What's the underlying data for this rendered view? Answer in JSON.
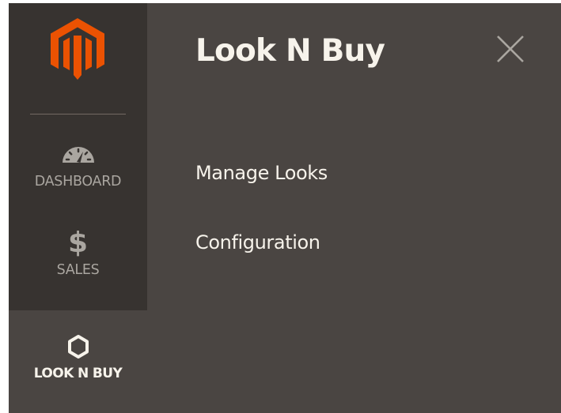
{
  "sidebar": {
    "logo": {
      "icon": "magento-logo-icon",
      "color": "#eb5202"
    },
    "items": [
      {
        "label": "DASHBOARD",
        "icon": "speedometer-icon"
      },
      {
        "label": "SALES",
        "icon": "dollar-sign-icon",
        "glyph": "$"
      },
      {
        "label": "LOOK N BUY",
        "icon": "hexagon-icon",
        "active": true
      }
    ]
  },
  "panel": {
    "title": "Look N Buy",
    "close_icon": "close-icon",
    "menu": [
      {
        "label": "Manage Looks"
      },
      {
        "label": "Configuration"
      }
    ]
  },
  "colors": {
    "sidebar_bg": "#373330",
    "panel_bg": "#4a4542",
    "text_light": "#f7f3eb",
    "text_muted": "#aaa6a0",
    "accent": "#eb5202"
  }
}
